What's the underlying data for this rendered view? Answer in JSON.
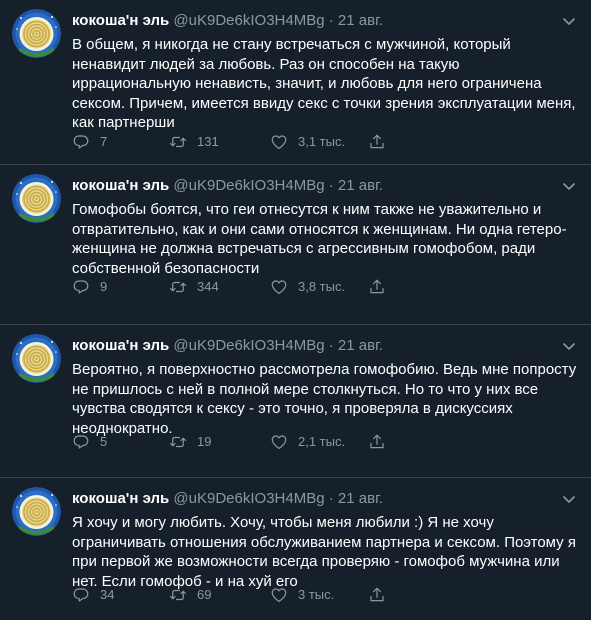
{
  "colors": {
    "background": "#15202b",
    "text": "#ffffff",
    "secondary": "#8899a6",
    "divider": "#38444d"
  },
  "tweets": [
    {
      "name": "кокоша'н эль",
      "handle": "@uK9De6kIO3H4MBg",
      "separator": "·",
      "date": "21 авг.",
      "text": "В общем, я никогда не стану встречаться с мужчиной, который ненавидит людей за любовь. Раз он способен на такую иррациональную ненависть, значит, и любовь для него ограничена сексом. Причем, имеется ввиду секс с точки зрения эксплуатации меня, как партнерши",
      "replies": "7",
      "retweets": "131",
      "likes": "3,1 тыс."
    },
    {
      "name": "кокоша'н эль",
      "handle": "@uK9De6kIO3H4MBg",
      "separator": "·",
      "date": "21 авг.",
      "text": "Гомофобы боятся, что геи отнесутся к ним также не уважительно и отвратительно, как и они сами относятся к женщинам. Ни одна гетеро-женщина не должна встречаться с агрессивным гомофобом, ради собственной безопасности",
      "replies": "9",
      "retweets": "344",
      "likes": "3,8 тыс."
    },
    {
      "name": "кокоша'н эль",
      "handle": "@uK9De6kIO3H4MBg",
      "separator": "·",
      "date": "21 авг.",
      "text": "Вероятно, я поверхностно рассмотрела гомофобию. Ведь мне попросту не пришлось с ней в полной мере столкнуться. Но то что у них все чувства сводятся к сексу - это точно, я проверяла в дискуссиях неоднократно.",
      "replies": "5",
      "retweets": "19",
      "likes": "2,1 тыс."
    },
    {
      "name": "кокоша'н эль",
      "handle": "@uK9De6kIO3H4MBg",
      "separator": "·",
      "date": "21 авг.",
      "text": "Я хочу и могу любить. Хочу, чтобы меня любили :) Я не хочу ограничивать отношения обслуживанием партнера и сексом. Поэтому я при первой же возможности всегда проверяю - гомофоб мужчина или нет. Если гомофоб - и на хуй его",
      "replies": "34",
      "retweets": "69",
      "likes": "3 тыс."
    }
  ]
}
